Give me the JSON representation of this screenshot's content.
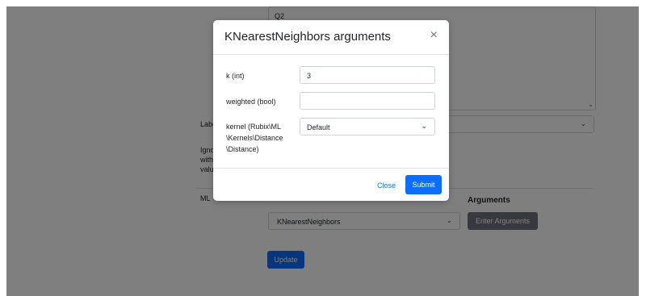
{
  "background": {
    "textarea_value": "Q2",
    "label_select_label": "Labe",
    "ignore_label_lines": [
      "Igno",
      "with",
      "valu"
    ],
    "ml_label": "ML",
    "arguments_heading": "Arguments",
    "algorithm_select_value": "KNearestNeighbors",
    "enter_arguments_label": "Enter Arguments",
    "update_label": "Update"
  },
  "modal": {
    "title": "KNearestNeighbors arguments",
    "close_icon": "×",
    "fields": [
      {
        "label": "k (int)",
        "value": "3"
      },
      {
        "label": "weighted (bool)",
        "value": ""
      },
      {
        "label_lines": [
          "kernel (Rubix\\ML",
          "\\Kernels\\Distance",
          "\\Distance)"
        ],
        "value": "Default"
      }
    ],
    "close_label": "Close",
    "submit_label": "Submit"
  },
  "colors": {
    "primary": "#0d6efd",
    "secondary": "#6c757d",
    "backdrop": "rgba(0,0,0,0.5)"
  }
}
